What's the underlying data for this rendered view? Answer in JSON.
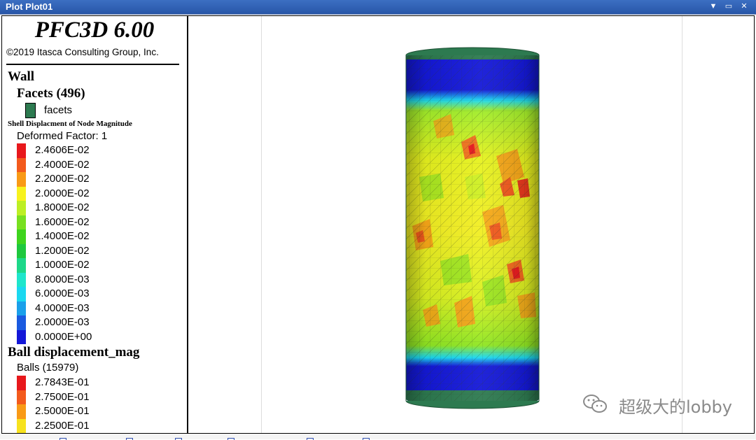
{
  "window": {
    "title": "Plot Plot01"
  },
  "legend": {
    "app_title": "PFC3D 6.00",
    "copyright": "©2019 Itasca Consulting Group, Inc.",
    "wall_header": "Wall",
    "facets_header": "Facets (496)",
    "facets_item": "facets",
    "facets_color": "#2d7a50",
    "shell_title": "Shell Displacment of Node Magnitude",
    "deformed": "Deformed Factor: 1",
    "shell_scale": [
      {
        "label": "2.4606E-02",
        "color": "#e8181c"
      },
      {
        "label": "2.4000E-02",
        "color": "#f35a1c"
      },
      {
        "label": "2.2000E-02",
        "color": "#f99a16"
      },
      {
        "label": "2.0000E-02",
        "color": "#f7f21e"
      },
      {
        "label": "1.8000E-02",
        "color": "#bdef24"
      },
      {
        "label": "1.6000E-02",
        "color": "#78e020"
      },
      {
        "label": "1.4000E-02",
        "color": "#3ed41e"
      },
      {
        "label": "1.2000E-02",
        "color": "#1ec83e"
      },
      {
        "label": "1.0000E-02",
        "color": "#1dd889"
      },
      {
        "label": "8.0000E-03",
        "color": "#1ee6cc"
      },
      {
        "label": "6.0000E-03",
        "color": "#1ad8f0"
      },
      {
        "label": "4.0000E-03",
        "color": "#1aa0ea"
      },
      {
        "label": "2.0000E-03",
        "color": "#1a5ae0"
      },
      {
        "label": "0.0000E+00",
        "color": "#1418d8"
      }
    ],
    "ball_header": "Ball displacement_mag",
    "balls_count": "Balls (15979)",
    "ball_scale": [
      {
        "label": "2.7843E-01",
        "color": "#e8181c"
      },
      {
        "label": "2.7500E-01",
        "color": "#f35a1c"
      },
      {
        "label": "2.5000E-01",
        "color": "#f99a16"
      },
      {
        "label": "2.2500E-01",
        "color": "#f7e21e"
      }
    ]
  },
  "watermark": {
    "text": "超级大的lobby"
  },
  "icons": {
    "menu": "dropdown-icon",
    "restore": "restore-icon",
    "close": "close-icon"
  }
}
